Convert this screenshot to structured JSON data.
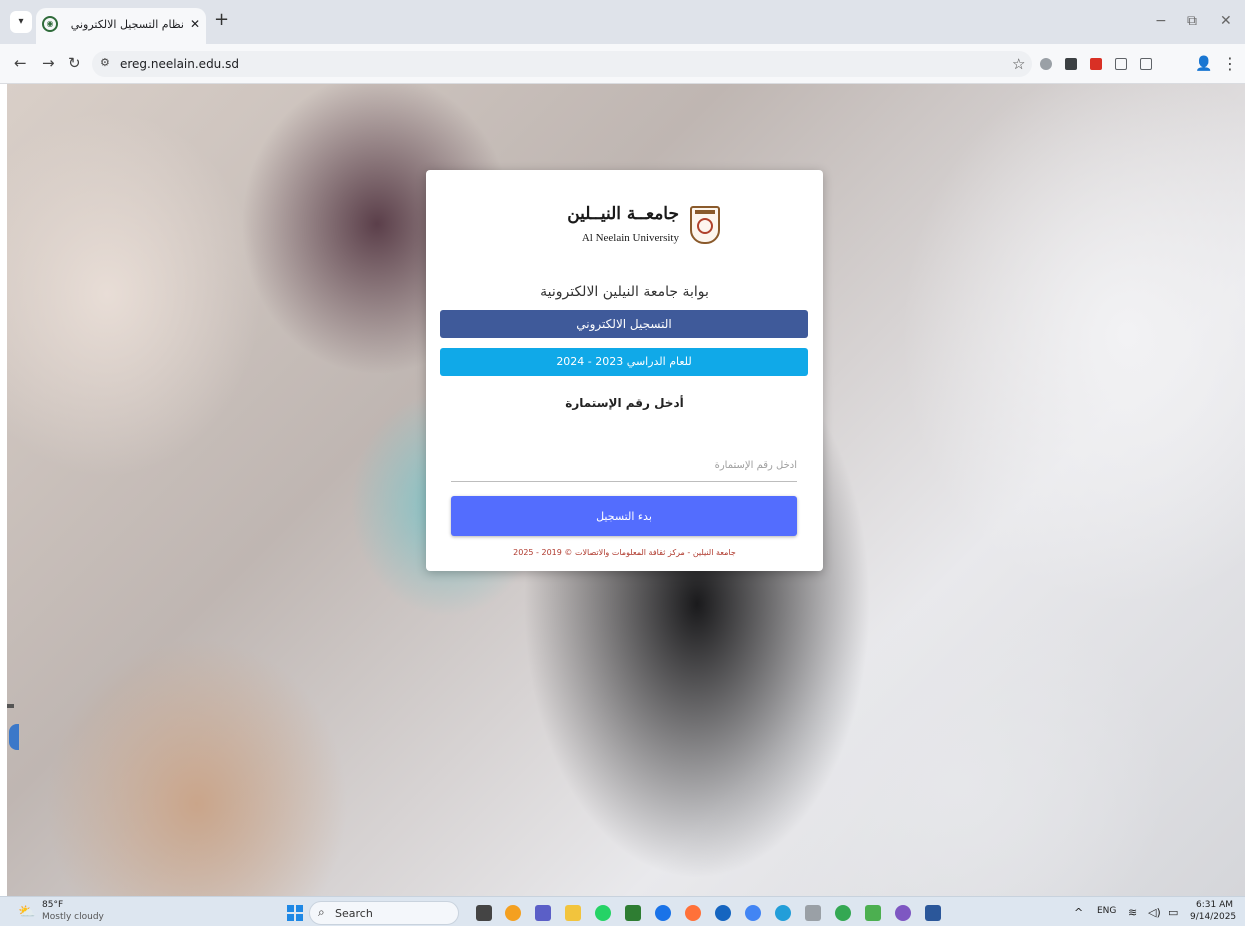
{
  "browser": {
    "tab_title": "نظام التسجيل الالكتروني",
    "tab_close": "✕",
    "new_tab": "+",
    "url": "ereg.neelain.edu.sd",
    "window_minimize": "−",
    "window_restore": "⧉",
    "window_close": "✕"
  },
  "card": {
    "logo_ar": "جامعــة النيــلين",
    "logo_en": "Al Neelain University",
    "portal_title": "بوابة جامعة النيلين الالكترونية",
    "band_registration": "التسجيل الالكتروني",
    "band_year": "للعام الدراسي 2023 - 2024",
    "enter_label": "أدخل رقم الإستمارة",
    "input_placeholder": "أدخل رقم الإستمارة",
    "input_value": "",
    "submit_label": "بدء التسجيل",
    "footer": "جامعة النيلين - مركز ثقافة المعلومات والاتصالات © 2019 - 2025"
  },
  "taskbar": {
    "weather_temp": "85°F",
    "weather_desc": "Mostly cloudy",
    "search_label": "Search",
    "lang": "ENG",
    "time": "6:31 AM",
    "date": "9/14/2025"
  },
  "icons": {
    "tab_menu": "chevron-down-icon",
    "favicon": "site-favicon-icon",
    "back": "back-arrow-icon",
    "forward": "forward-arrow-icon",
    "reload": "reload-icon",
    "site_info": "site-info-icon",
    "bookmark": "star-icon",
    "menu": "more-vert-icon"
  },
  "colors": {
    "band_registration": "#3f5a9a",
    "band_year": "#10a9e8",
    "submit": "#536dfe",
    "footer_text": "#b03a2e"
  }
}
